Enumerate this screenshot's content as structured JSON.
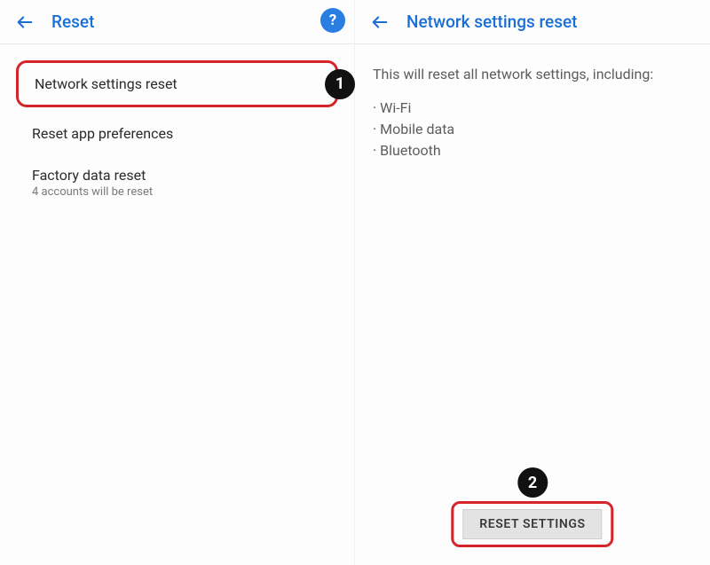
{
  "left": {
    "title": "Reset",
    "callout": "1",
    "items": [
      {
        "label": "Network settings reset"
      },
      {
        "label": "Reset app preferences"
      },
      {
        "label": "Factory data reset",
        "sub": "4 accounts will be reset"
      }
    ]
  },
  "right": {
    "title": "Network settings reset",
    "intro": "This will reset all network settings, including:",
    "bullets": [
      "Wi-Fi",
      "Mobile data",
      "Bluetooth"
    ],
    "callout": "2",
    "button_label": "RESET SETTINGS"
  },
  "help_glyph": "?"
}
